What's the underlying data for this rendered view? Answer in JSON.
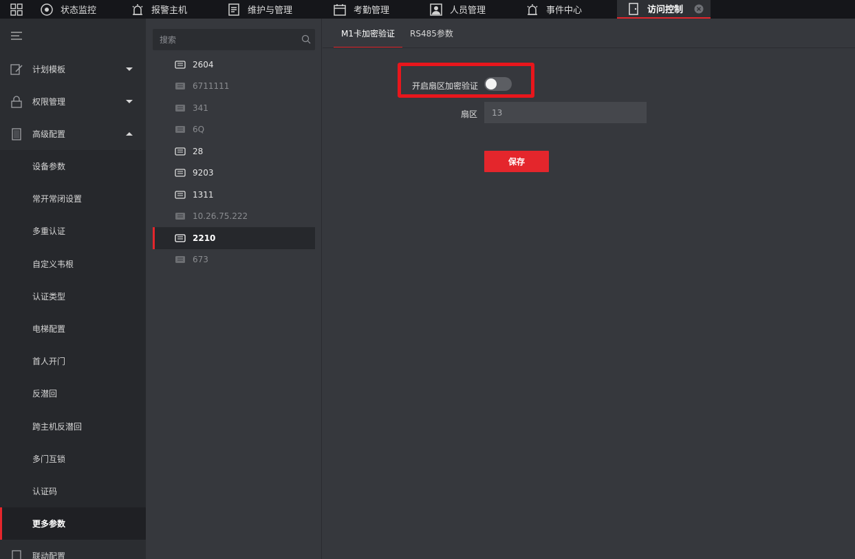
{
  "topnav": {
    "tabs": [
      {
        "label": "状态监控",
        "icon": "monitor-icon"
      },
      {
        "label": "报警主机",
        "icon": "alarm-icon"
      },
      {
        "label": "维护与管理",
        "icon": "maintenance-icon"
      },
      {
        "label": "考勤管理",
        "icon": "calendar-icon"
      },
      {
        "label": "人员管理",
        "icon": "person-icon"
      },
      {
        "label": "事件中心",
        "icon": "alarm-icon"
      },
      {
        "label": "访问控制",
        "icon": "door-icon"
      }
    ],
    "active_tab": "访问控制",
    "accent_color": "#e4262c"
  },
  "sidebar": {
    "groups": [
      {
        "label": "计划模板",
        "icon": "edit-icon",
        "expanded": false
      },
      {
        "label": "权限管理",
        "icon": "lock-icon",
        "expanded": false
      },
      {
        "label": "高级配置",
        "icon": "config-icon",
        "expanded": true
      }
    ],
    "sub_items": [
      "设备参数",
      "常开常闭设置",
      "多重认证",
      "自定义韦根",
      "认证类型",
      "电梯配置",
      "首人开门",
      "反潜回",
      "跨主机反潜回",
      "多门互锁",
      "认证码",
      "更多参数"
    ],
    "active_sub": "更多参数",
    "footer_group": {
      "label": "联动配置",
      "icon": "link-icon"
    }
  },
  "devices": {
    "search_placeholder": "搜索",
    "items": [
      {
        "name": "2604",
        "online": true
      },
      {
        "name": "6711111",
        "online": false
      },
      {
        "name": "341",
        "online": false
      },
      {
        "name": "6Q",
        "online": false
      },
      {
        "name": "28",
        "online": true
      },
      {
        "name": "9203",
        "online": true
      },
      {
        "name": "1311",
        "online": true
      },
      {
        "name": "10.26.75.222",
        "online": false
      },
      {
        "name": "2210",
        "online": true,
        "selected": true
      },
      {
        "name": "673",
        "online": false
      }
    ]
  },
  "main": {
    "tabs": [
      "M1卡加密验证",
      "RS485参数"
    ],
    "active_tab": "M1卡加密验证",
    "form": {
      "enable_label": "开启扇区加密验证",
      "enable_value": false,
      "sector_label": "扇区",
      "sector_value": "13",
      "save_label": "保存"
    }
  }
}
